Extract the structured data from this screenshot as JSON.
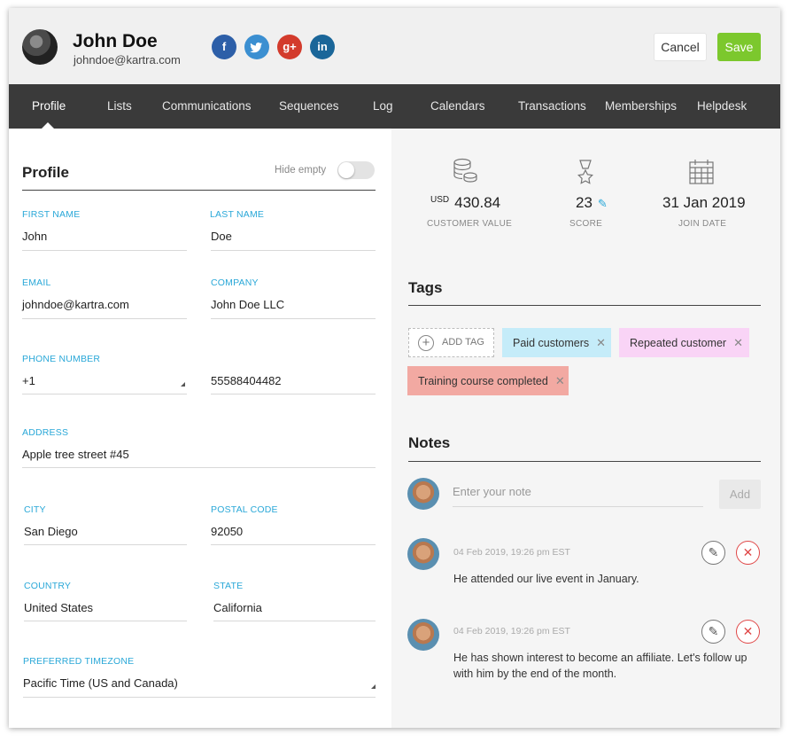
{
  "header": {
    "name": "John Doe",
    "email": "johndoe@kartra.com",
    "social": [
      {
        "icon": "facebook-icon",
        "glyph": "f",
        "color": "#2d5fa8"
      },
      {
        "icon": "twitter-icon",
        "glyph": "t",
        "color": "#3b8fd1"
      },
      {
        "icon": "google-plus-icon",
        "glyph": "g+",
        "color": "#d33b2c"
      },
      {
        "icon": "linkedin-icon",
        "glyph": "in",
        "color": "#1a6699"
      }
    ],
    "cancel_label": "Cancel",
    "save_label": "Save"
  },
  "nav": {
    "items": [
      "Profile",
      "Lists",
      "Communications",
      "Sequences",
      "Log",
      "Calendars",
      "Transactions",
      "Memberships",
      "Helpdesk"
    ],
    "active": "Profile"
  },
  "profile": {
    "title": "Profile",
    "hide_empty_label": "Hide empty",
    "hide_empty_on": false,
    "fields": {
      "first_name": {
        "label": "FIRST NAME",
        "value": "John"
      },
      "last_name": {
        "label": "LAST NAME",
        "value": "Doe"
      },
      "email": {
        "label": "EMAIL",
        "value": "johndoe@kartra.com"
      },
      "company": {
        "label": "COMPANY",
        "value": "John Doe LLC"
      },
      "phone": {
        "label": "PHONE NUMBER",
        "code": "+1",
        "number": "55588404482"
      },
      "address": {
        "label": "ADDRESS",
        "value": "Apple tree street #45"
      },
      "city": {
        "label": "CITY",
        "value": "San Diego"
      },
      "postal_code": {
        "label": "POSTAL CODE",
        "value": "92050"
      },
      "country": {
        "label": "COUNTRY",
        "value": "United States"
      },
      "state": {
        "label": "STATE",
        "value": "California"
      },
      "timezone": {
        "label": "PREFERRED TIMEZONE",
        "value": "Pacific Time (US and Canada)"
      }
    }
  },
  "stats": {
    "customer_value": {
      "currency": "USD",
      "value": "430.84",
      "label": "CUSTOMER VALUE",
      "icon": "coins-icon"
    },
    "score": {
      "value": "23",
      "label": "SCORE",
      "icon": "medal-icon"
    },
    "join_date": {
      "value": "31 Jan 2019",
      "label": "JOIN DATE",
      "icon": "calendar-icon"
    }
  },
  "tags": {
    "title": "Tags",
    "add_label": "ADD TAG",
    "items": [
      {
        "label": "Paid customers",
        "color": "#c5ecf9"
      },
      {
        "label": "Repeated customer",
        "color": "#f9d4f6"
      },
      {
        "label": "Training course completed",
        "color": "#f2a9a2"
      }
    ]
  },
  "notes": {
    "title": "Notes",
    "placeholder": "Enter your note",
    "add_label": "Add",
    "items": [
      {
        "time": "04 Feb 2019, 19:26 pm EST",
        "lines": [
          "He attended our live event in January."
        ]
      },
      {
        "time": "04 Feb 2019, 19:26 pm EST",
        "lines": [
          "He has shown interest to become an affiliate. Let's follow up",
          "with him by the end of the month."
        ]
      }
    ]
  },
  "colors": {
    "accent": "#2aa8d8",
    "save": "#7cc82d",
    "nav_bg": "#3a3a3a",
    "delete": "#e04848"
  }
}
